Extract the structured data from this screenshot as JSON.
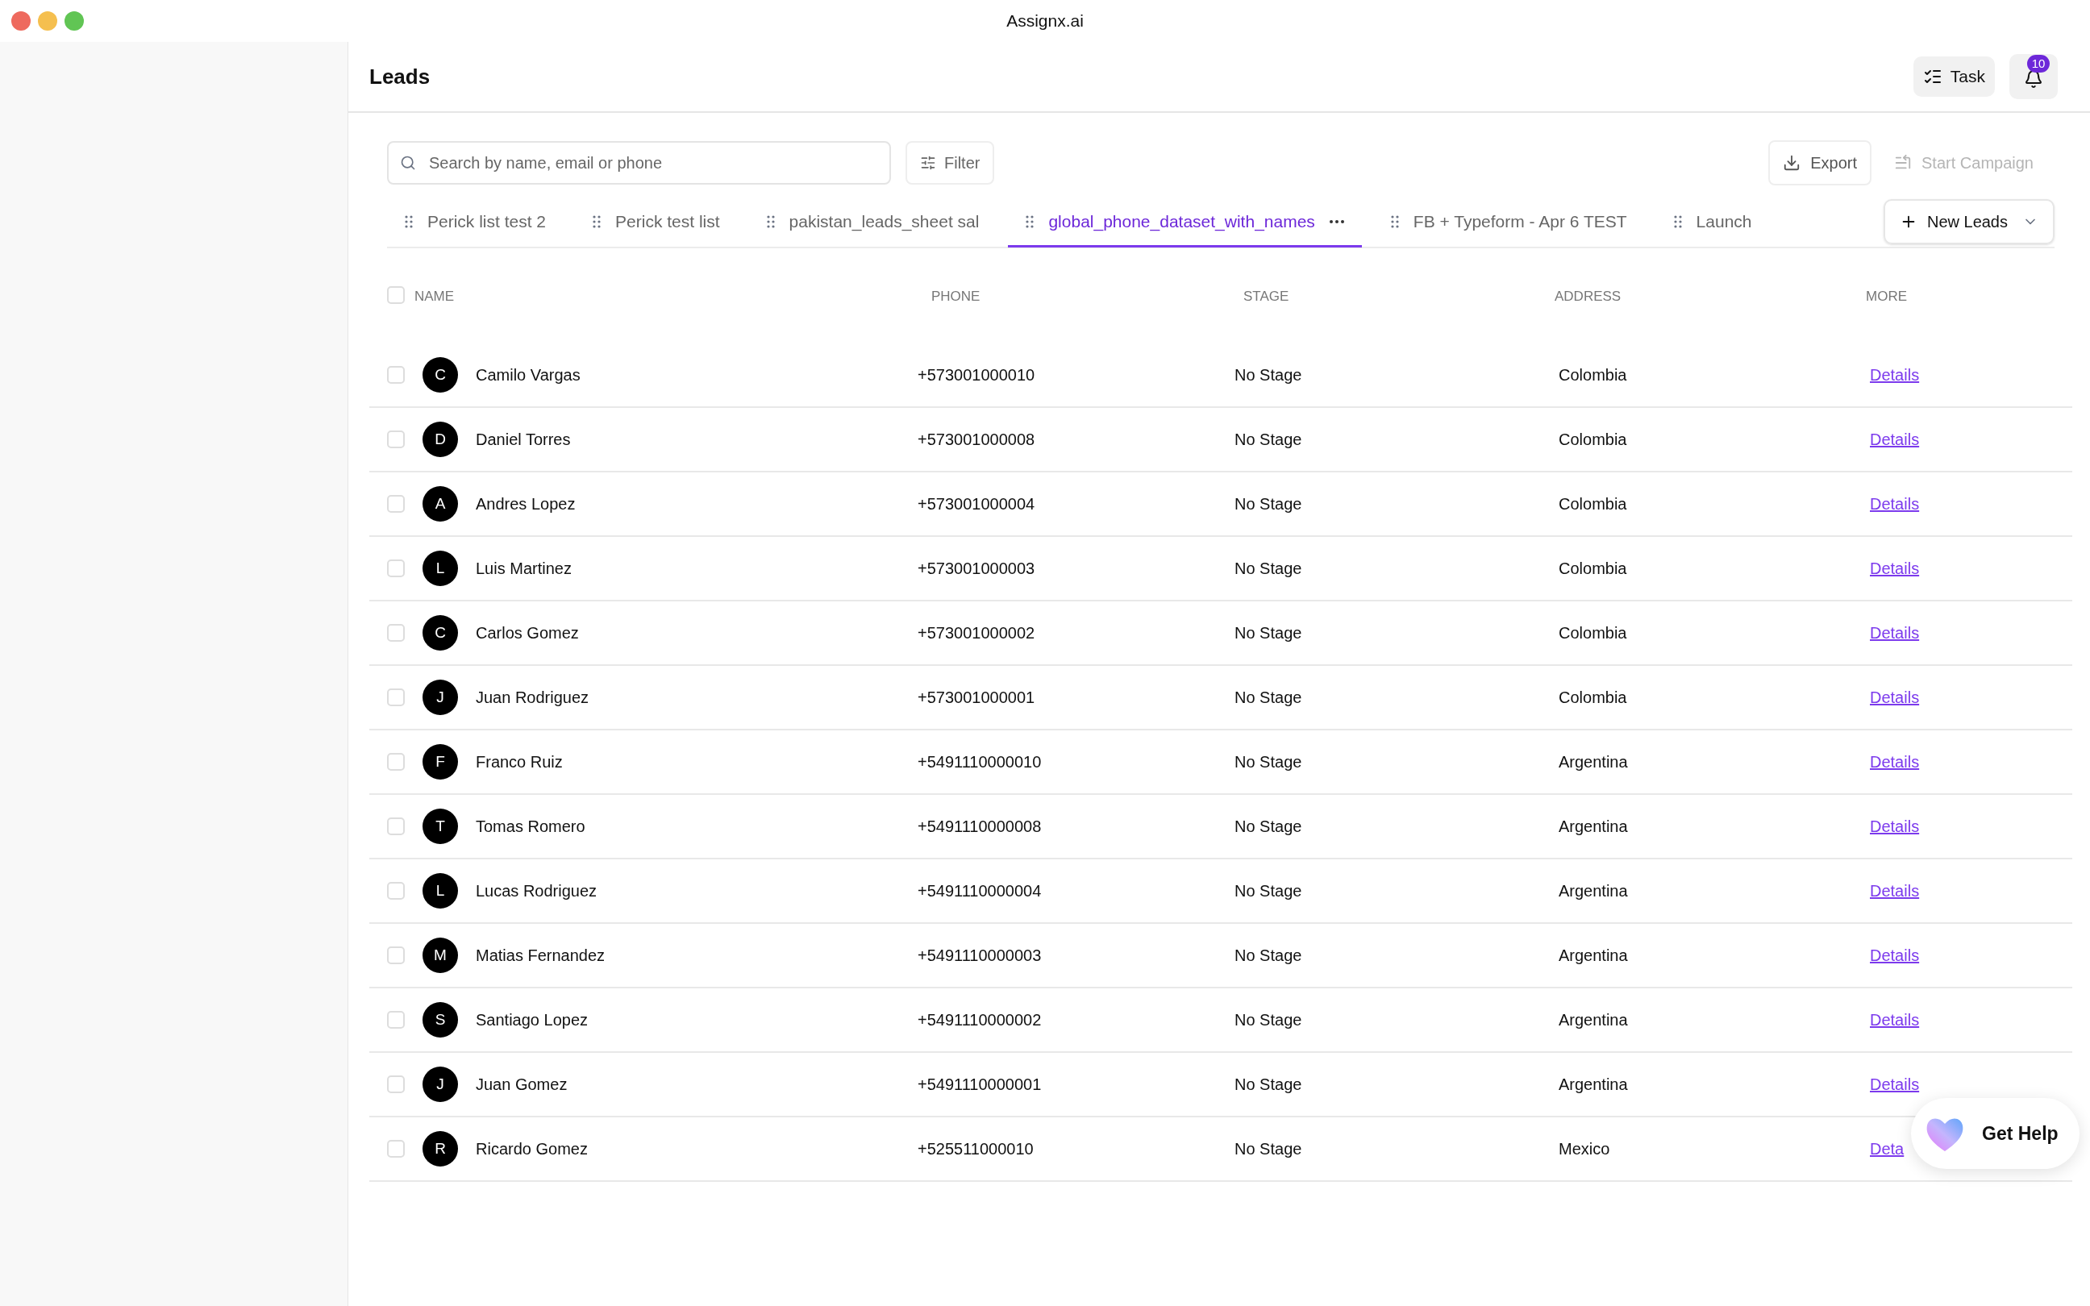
{
  "window": {
    "title": "Assignx.ai"
  },
  "header": {
    "title": "Leads",
    "task_button": "Task",
    "notifications": {
      "count": "10"
    }
  },
  "toolbar": {
    "search": {
      "placeholder": "Search by name, email or phone"
    },
    "filter": "Filter",
    "export": "Export",
    "start_campaign": {
      "label": "Start Campaign",
      "disabled": true
    }
  },
  "tabs": [
    {
      "label": "Perick list test 2",
      "selected": false
    },
    {
      "label": "Perick test list",
      "selected": false
    },
    {
      "label": "pakistan_leads_sheet sal",
      "selected": false
    },
    {
      "label": "global_phone_dataset_with_names",
      "selected": true
    },
    {
      "label": "FB + Typeform - Apr 6 TEST",
      "selected": false
    },
    {
      "label": "Launch",
      "selected": false
    }
  ],
  "new_leads_button": "New Leads",
  "table": {
    "select_all_checked": false,
    "columns": [
      "NAME",
      "PHONE",
      "STAGE",
      "ADDRESS",
      "MORE"
    ],
    "rows": [
      {
        "initial": "C",
        "name": "Camilo Vargas",
        "phone": "+573001000010",
        "stage": "No Stage",
        "address": "Colombia",
        "more": "Details",
        "checked": false
      },
      {
        "initial": "D",
        "name": "Daniel Torres",
        "phone": "+573001000008",
        "stage": "No Stage",
        "address": "Colombia",
        "more": "Details",
        "checked": false
      },
      {
        "initial": "A",
        "name": "Andres Lopez",
        "phone": "+573001000004",
        "stage": "No Stage",
        "address": "Colombia",
        "more": "Details",
        "checked": false
      },
      {
        "initial": "L",
        "name": "Luis Martinez",
        "phone": "+573001000003",
        "stage": "No Stage",
        "address": "Colombia",
        "more": "Details",
        "checked": false
      },
      {
        "initial": "C",
        "name": "Carlos Gomez",
        "phone": "+573001000002",
        "stage": "No Stage",
        "address": "Colombia",
        "more": "Details",
        "checked": false
      },
      {
        "initial": "J",
        "name": "Juan Rodriguez",
        "phone": "+573001000001",
        "stage": "No Stage",
        "address": "Colombia",
        "more": "Details",
        "checked": false
      },
      {
        "initial": "F",
        "name": "Franco Ruiz",
        "phone": "+5491110000010",
        "stage": "No Stage",
        "address": "Argentina",
        "more": "Details",
        "checked": false
      },
      {
        "initial": "T",
        "name": "Tomas Romero",
        "phone": "+5491110000008",
        "stage": "No Stage",
        "address": "Argentina",
        "more": "Details",
        "checked": false
      },
      {
        "initial": "L",
        "name": "Lucas Rodriguez",
        "phone": "+5491110000004",
        "stage": "No Stage",
        "address": "Argentina",
        "more": "Details",
        "checked": false
      },
      {
        "initial": "M",
        "name": "Matias Fernandez",
        "phone": "+5491110000003",
        "stage": "No Stage",
        "address": "Argentina",
        "more": "Details",
        "checked": false
      },
      {
        "initial": "S",
        "name": "Santiago Lopez",
        "phone": "+5491110000002",
        "stage": "No Stage",
        "address": "Argentina",
        "more": "Details",
        "checked": false
      },
      {
        "initial": "J",
        "name": "Juan Gomez",
        "phone": "+5491110000001",
        "stage": "No Stage",
        "address": "Argentina",
        "more": "Details",
        "checked": false
      },
      {
        "initial": "R",
        "name": "Ricardo Gomez",
        "phone": "+525511000010",
        "stage": "No Stage",
        "address": "Mexico",
        "more": "Deta",
        "checked": false
      }
    ]
  },
  "help_button": "Get Help"
}
